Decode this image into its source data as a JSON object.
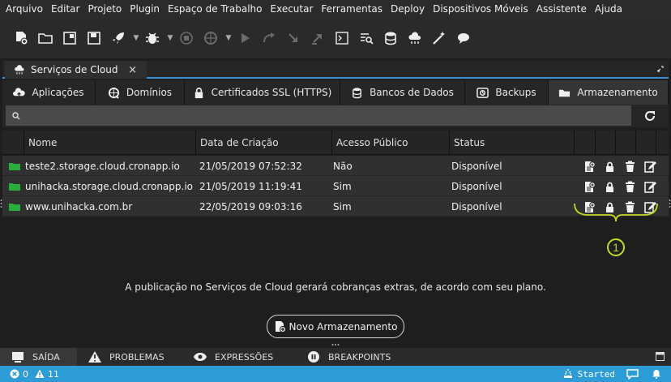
{
  "menu": [
    "Arquivo",
    "Editar",
    "Projeto",
    "Plugin",
    "Espaço de Trabalho",
    "Executar",
    "Ferramentas",
    "Deploy",
    "Dispositivos Móveis",
    "Assistente",
    "Ajuda"
  ],
  "toolbar": {
    "icons": [
      "new-file-icon",
      "folder-icon",
      "project-icon",
      "save-icon",
      "rocket-icon",
      "bug-icon",
      "stop-icon",
      "globe-icon",
      "play-icon",
      "step-over-icon",
      "step-into-icon",
      "step-out-icon",
      "terminal-icon",
      "search-list-icon",
      "database-icon",
      "cloud-icon",
      "magic-wand-icon",
      "chat-icon"
    ]
  },
  "panel": {
    "tab_title": "Serviços de Cloud",
    "close": "×"
  },
  "subtabs": [
    {
      "label": "Aplicações",
      "icon": "cloud-upload-icon"
    },
    {
      "label": "Domínios",
      "icon": "globe-icon"
    },
    {
      "label": "Certificados SSL (HTTPS)",
      "icon": "lock-icon"
    },
    {
      "label": "Bancos de Dados",
      "icon": "database-icon"
    },
    {
      "label": "Backups",
      "icon": "backup-icon"
    },
    {
      "label": "Armazenamento",
      "icon": "folder-icon",
      "active": true
    }
  ],
  "search": {
    "placeholder": ""
  },
  "table": {
    "columns": [
      "Nome",
      "Data de Criação",
      "Acesso Público",
      "Status"
    ],
    "rows": [
      {
        "name": "teste2.storage.cloud.cronapp.io",
        "date": "21/05/2019 07:52:32",
        "access": "Não",
        "status": "Disponível"
      },
      {
        "name": "unihacka.storage.cloud.cronapp.io",
        "date": "21/05/2019 11:19:41",
        "access": "Sim",
        "status": "Disponível"
      },
      {
        "name": "www.unihacka.com.br",
        "date": "22/05/2019 09:03:16",
        "access": "Sim",
        "status": "Disponível"
      }
    ],
    "row_actions": [
      "file-upload-icon",
      "lock-icon",
      "trash-icon",
      "edit-icon"
    ]
  },
  "message": "A publicação no Serviços de Cloud gerará cobranças extras, de acordo com seu plano.",
  "new_button": "Novo Armazenamento",
  "callout_label": "1",
  "bottom_tabs": [
    {
      "label": "SAÍDA",
      "icon": "monitor-icon",
      "active": true
    },
    {
      "label": "PROBLEMAS",
      "icon": "warning-icon"
    },
    {
      "label": "EXPRESSÕES",
      "icon": "eye-icon"
    },
    {
      "label": "BREAKPOINTS",
      "icon": "pause-icon"
    }
  ],
  "status": {
    "errors": "0",
    "warnings": "11",
    "state": "Started"
  },
  "colors": {
    "accent": "#2d9bd6",
    "folder": "#27ae3c",
    "callout": "#c4d82a"
  }
}
